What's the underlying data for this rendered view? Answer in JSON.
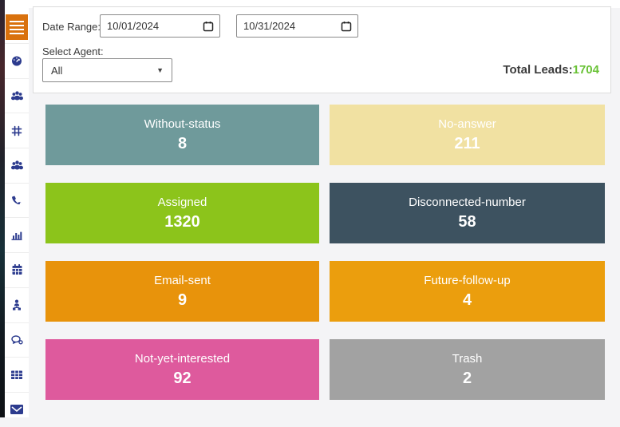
{
  "app": {
    "background": "#f4f4f6"
  },
  "sidebar": {
    "accent_color": "#d9710d",
    "icon_color": "#2c3b8e",
    "menu_button": {
      "icon": "hamburger-icon"
    },
    "items": [
      {
        "icon": "dashboard-icon"
      },
      {
        "icon": "users-icon"
      },
      {
        "icon": "hash-icon"
      },
      {
        "icon": "user-group-icon"
      },
      {
        "icon": "phone-icon"
      },
      {
        "icon": "bar-chart-icon"
      },
      {
        "icon": "calendar-icon"
      },
      {
        "icon": "person-network-icon"
      },
      {
        "icon": "comments-icon"
      },
      {
        "icon": "table-icon"
      },
      {
        "icon": "envelope-icon"
      }
    ]
  },
  "filters": {
    "date_range_label": "Date Range:",
    "date_from": "10/01/2024",
    "date_to": "10/31/2024",
    "select_agent_label": "Select Agent:",
    "agent_selected": "All"
  },
  "summary": {
    "total_leads_label": "Total Leads:",
    "total_leads_value": "1704",
    "value_color": "#69c236"
  },
  "status_cards": [
    {
      "label": "Without-status",
      "value": "8",
      "color": "#6f9a9b"
    },
    {
      "label": "No-answer",
      "value": "211",
      "color": "#f1e1a2"
    },
    {
      "label": "Assigned",
      "value": "1320",
      "color": "#8cc41b"
    },
    {
      "label": "Disconnected-number",
      "value": "58",
      "color": "#3d5260"
    },
    {
      "label": "Email-sent",
      "value": "9",
      "color": "#e8930b"
    },
    {
      "label": "Future-follow-up",
      "value": "4",
      "color": "#eb9e0d"
    },
    {
      "label": "Not-yet-interested",
      "value": "92",
      "color": "#de5a9d"
    },
    {
      "label": "Trash",
      "value": "2",
      "color": "#a2a2a2"
    }
  ]
}
